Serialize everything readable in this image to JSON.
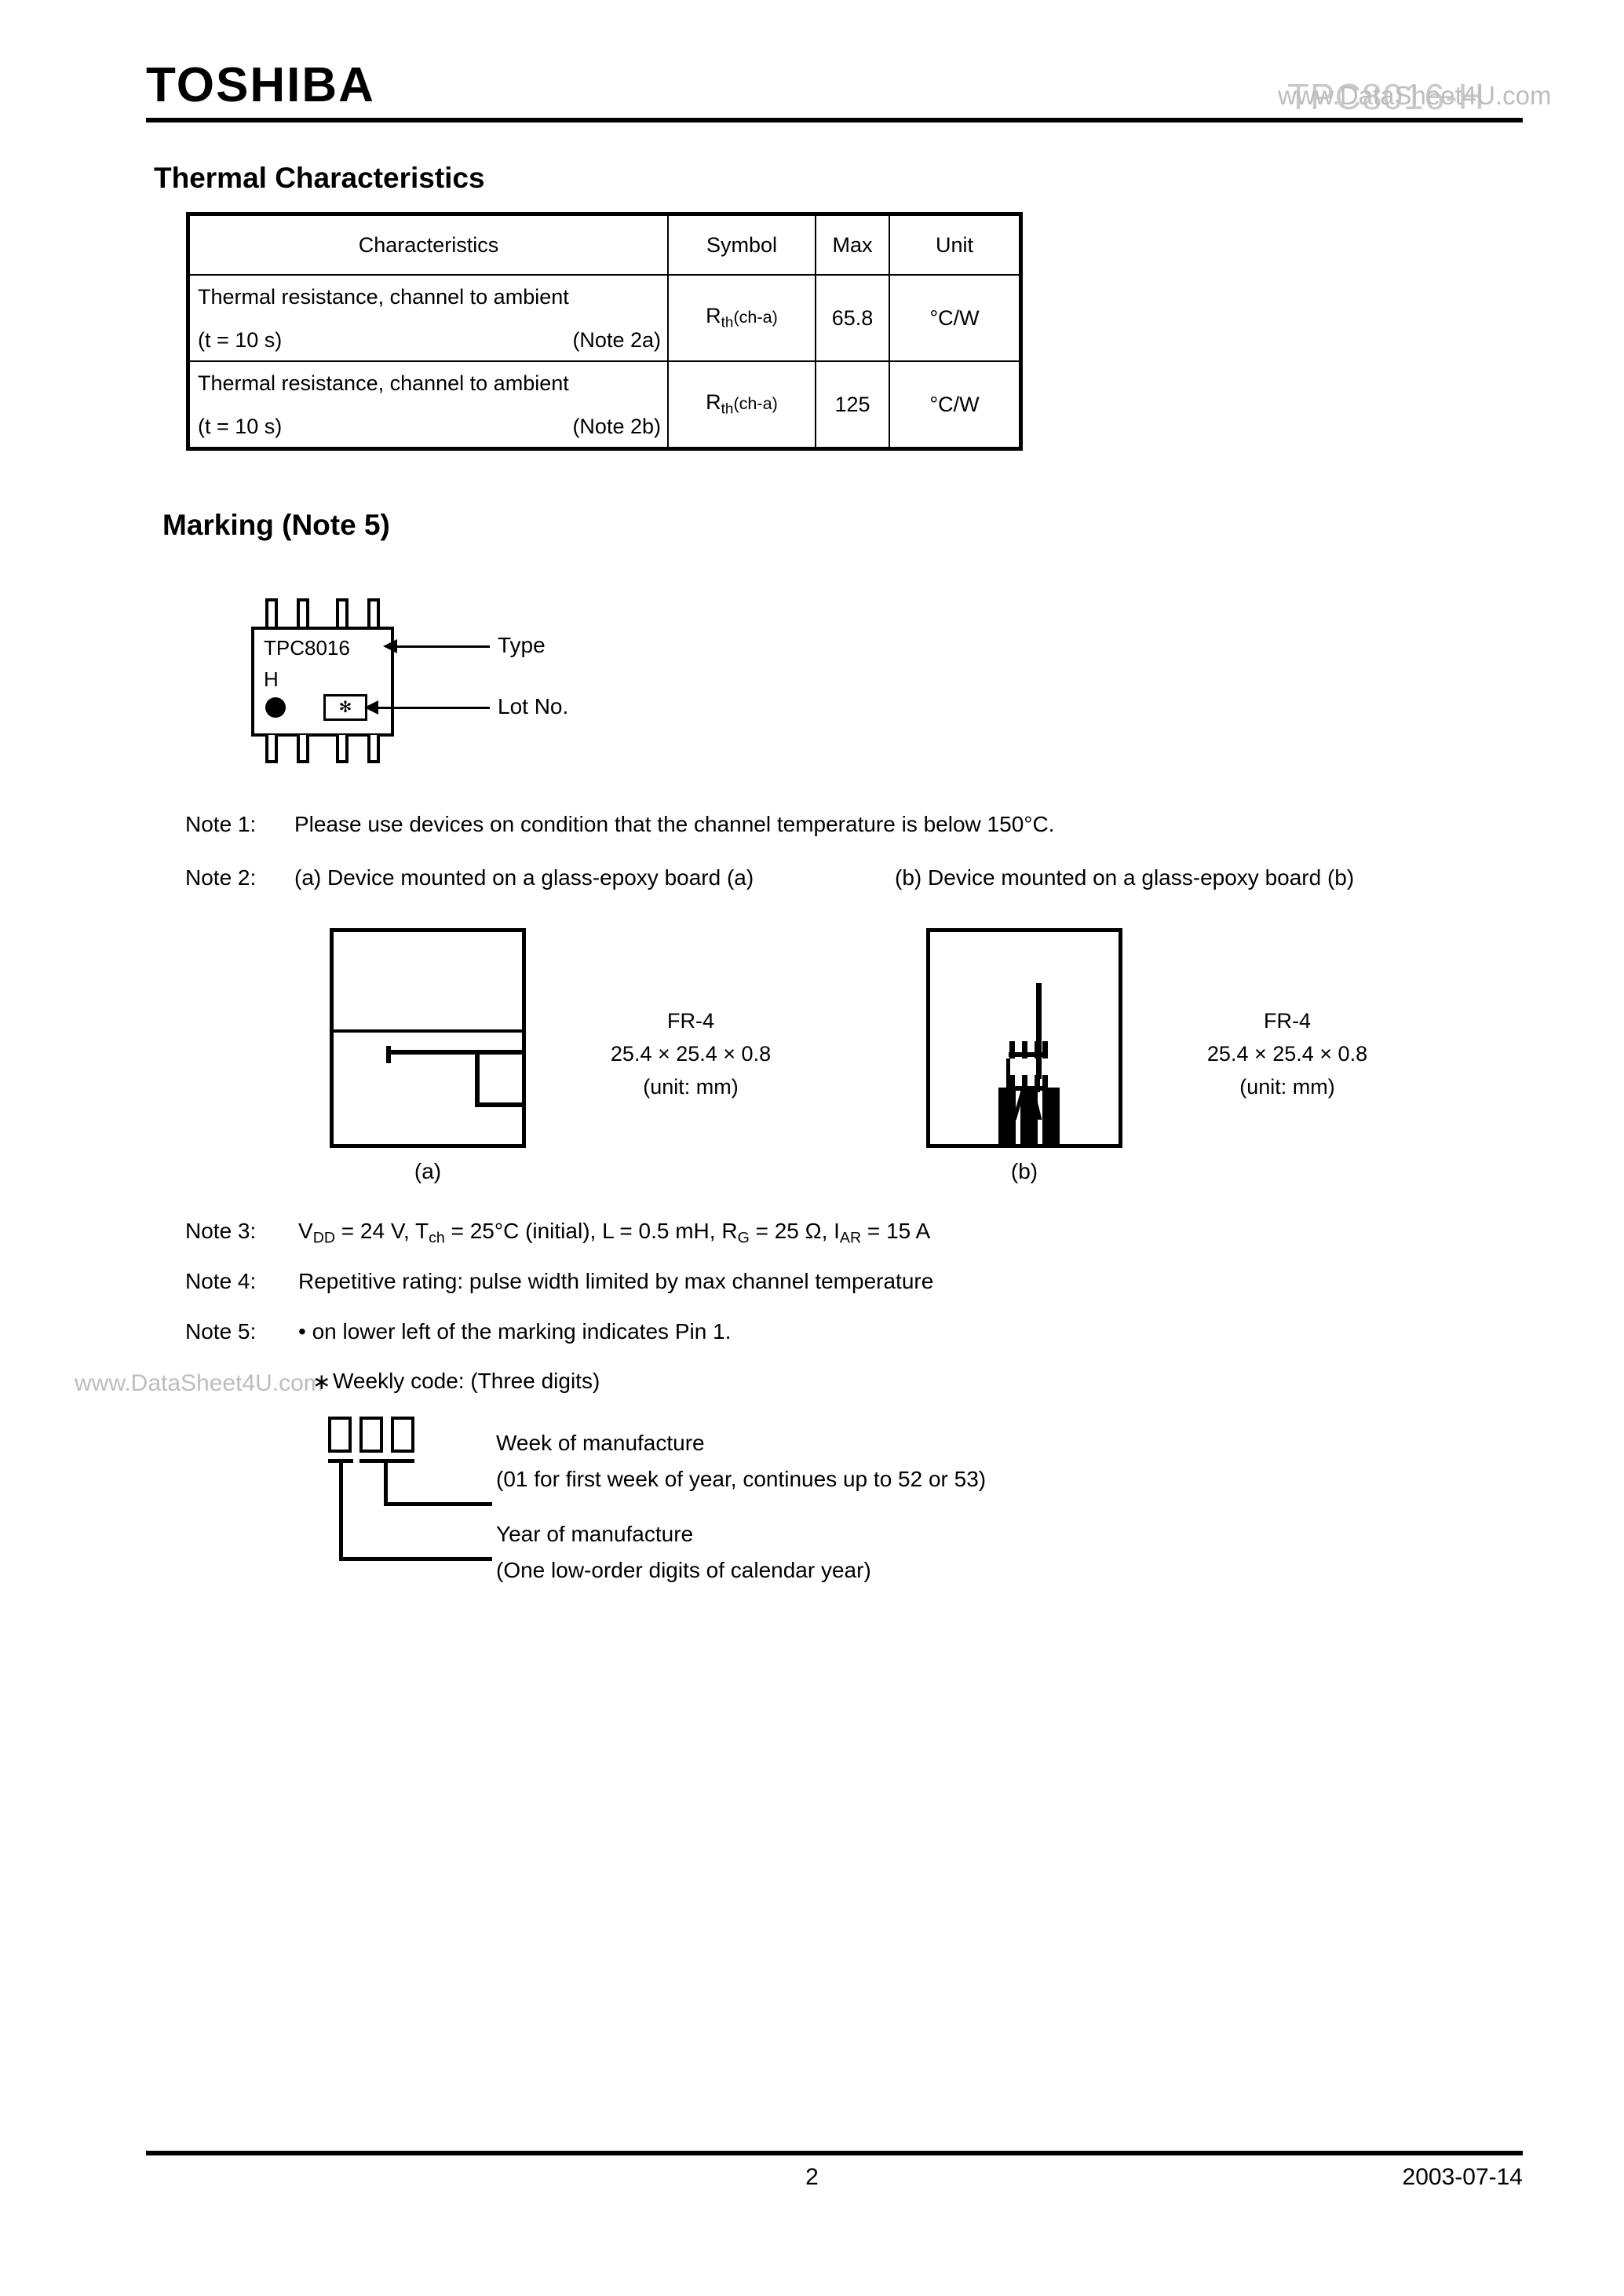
{
  "header": {
    "brand": "TOSHIBA",
    "part_number": "TPC8016-H",
    "watermark": "www.DataSheet4U.com"
  },
  "thermal_section": {
    "heading": "Thermal Characteristics",
    "columns": [
      "Characteristics",
      "Symbol",
      "Max",
      "Unit"
    ],
    "rows": [
      {
        "characteristic_line1": "Thermal resistance, channel to ambient",
        "characteristic_line2": "(t = 10 s)",
        "note_ref": "(Note 2a)",
        "symbol_main": "R",
        "symbol_sub": "th",
        "symbol_qualifier": "(ch-a)",
        "max": "65.8",
        "unit": "°C/W"
      },
      {
        "characteristic_line1": "Thermal resistance, channel to ambient",
        "characteristic_line2": "(t = 10 s)",
        "note_ref": "(Note 2b)",
        "symbol_main": "R",
        "symbol_sub": "th",
        "symbol_qualifier": "(ch-a)",
        "max": "125",
        "unit": "°C/W"
      }
    ]
  },
  "marking_section": {
    "heading": "Marking (Note 5)",
    "package_type_text": "TPC8016",
    "package_suffix_text": "H",
    "lot_symbol": "✻",
    "callout_type": "Type",
    "callout_lot": "Lot No."
  },
  "notes": {
    "note1_label": "Note 1:",
    "note1_text": "Please use devices on condition that the channel temperature is below 150°C.",
    "note2_label": "Note 2:",
    "note2a_text": "(a) Device mounted on a glass-epoxy board (a)",
    "note2b_text": "(b) Device mounted on a glass-epoxy board (b)",
    "note3_label": "Note 3:",
    "note3_parts": {
      "v_main": "V",
      "v_sub": "DD",
      "v_val": " = 24 V, ",
      "t_main": "T",
      "t_sub": "ch",
      "t_val": " = 25°C (initial), L = 0.5 mH, ",
      "r_main": "R",
      "r_sub": "G",
      "r_val": " = 25 Ω, ",
      "i_main": "I",
      "i_sub": "AR",
      "i_val": " = 15 A"
    },
    "note4_label": "Note 4:",
    "note4_text": "Repetitive rating: pulse width limited by max channel temperature",
    "note5_label": "Note 5:",
    "note5_text": "• on lower left of the marking indicates Pin 1."
  },
  "boards": {
    "a": {
      "caption": "(a)",
      "material": "FR-4",
      "dimensions": "25.4 × 25.4 × 0.8",
      "unit_note": "(unit: mm)"
    },
    "b": {
      "caption": "(b)",
      "material": "FR-4",
      "dimensions": "25.4 × 25.4 × 0.8",
      "unit_note": "(unit: mm)"
    }
  },
  "weekly_code": {
    "asterisk": "∗",
    "title": "Weekly code: (Three digits)",
    "week_label": "Week of manufacture",
    "week_detail": "(01 for first week of year, continues up to 52 or 53)",
    "year_label": "Year of manufacture",
    "year_detail": "(One low-order digits of calendar year)"
  },
  "footer": {
    "page_number": "2",
    "date": "2003-07-14"
  }
}
